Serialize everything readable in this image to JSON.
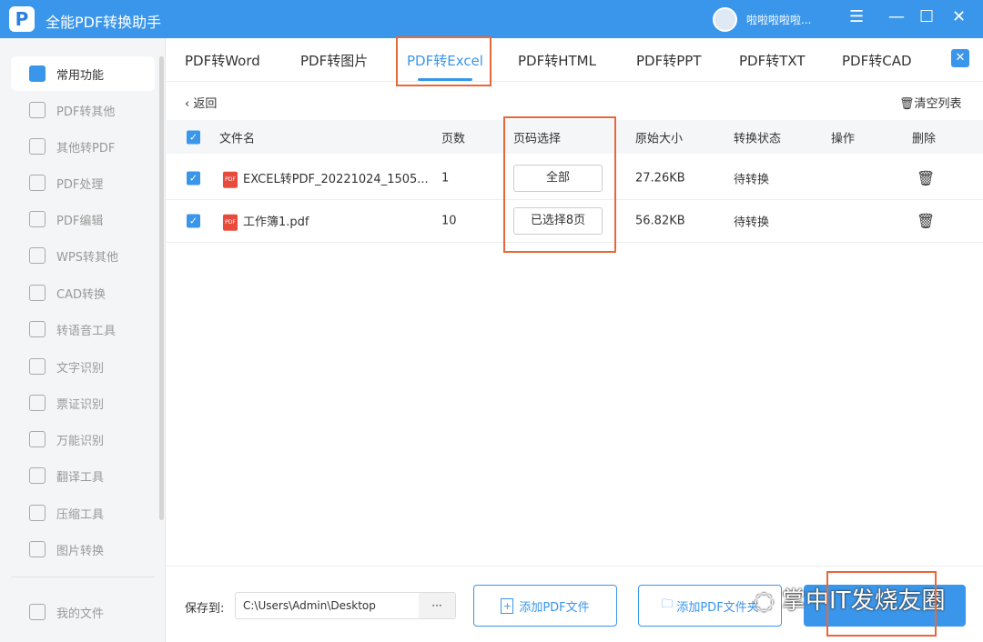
{
  "app": {
    "title": "全能PDF转换助手",
    "user": "啦啦啦啦啦..."
  },
  "window": {
    "menu": "☰",
    "minimize": "—",
    "maximize": "☐",
    "close": "✕"
  },
  "sidebar": {
    "items": [
      {
        "label": "常用功能",
        "active": true
      },
      {
        "label": "PDF转其他"
      },
      {
        "label": "其他转PDF"
      },
      {
        "label": "PDF处理"
      },
      {
        "label": "PDF编辑"
      },
      {
        "label": "WPS转其他"
      },
      {
        "label": "CAD转换"
      },
      {
        "label": "转语音工具"
      },
      {
        "label": "文字识别"
      },
      {
        "label": "票证识别"
      },
      {
        "label": "万能识别"
      },
      {
        "label": "翻译工具"
      },
      {
        "label": "压缩工具"
      },
      {
        "label": "图片转换"
      }
    ],
    "my_files": "我的文件"
  },
  "tabs": [
    {
      "label": "PDF转Word"
    },
    {
      "label": "PDF转图片"
    },
    {
      "label": "PDF转Excel",
      "active": true
    },
    {
      "label": "PDF转HTML"
    },
    {
      "label": "PDF转PPT"
    },
    {
      "label": "PDF转TXT"
    },
    {
      "label": "PDF转CAD"
    }
  ],
  "toolbar": {
    "back": "返回",
    "clear": "清空列表"
  },
  "table": {
    "headers": [
      "文件名",
      "页数",
      "页码选择",
      "原始大小",
      "转换状态",
      "操作",
      "删除"
    ],
    "rows": [
      {
        "name": "EXCEL转PDF_20221024_1505...",
        "pages": "1",
        "page_select": "全部",
        "size": "27.26KB",
        "status": "待转换",
        "checked": true
      },
      {
        "name": "工作簿1.pdf",
        "pages": "10",
        "page_select": "已选择8页",
        "size": "56.82KB",
        "status": "待转换",
        "checked": true
      }
    ]
  },
  "bottom": {
    "save_label": "保存到:",
    "save_path": "C:\\Users\\Admin\\Desktop",
    "browse": "···",
    "add_file": "添加PDF文件",
    "add_folder": "添加PDF文件夹"
  },
  "watermark": "掌中IT发烧友圈",
  "colors": {
    "accent": "#3a96ea",
    "highlight": "#e8683a",
    "pdf_icon": "#e84a3c"
  }
}
